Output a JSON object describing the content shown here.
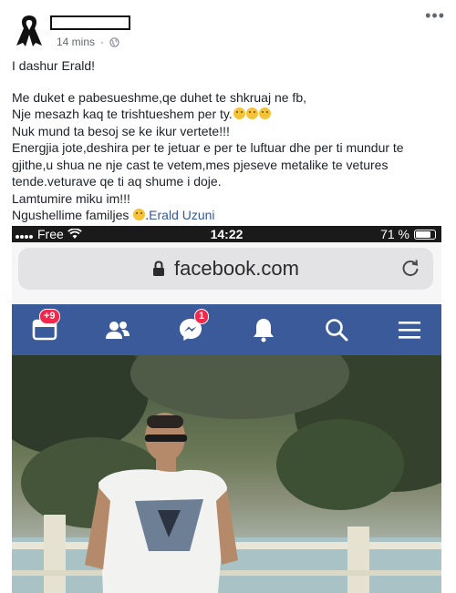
{
  "post": {
    "timestamp": "14 mins",
    "paragraphs": {
      "greeting": "I dashur Erald!",
      "l1": "Me duket e pabesueshme,qe duhet te shkruaj ne fb,",
      "l2": "Nje mesazh kaq te trishtueshem per ty.",
      "l3": "Nuk mund ta besoj se ke ikur vertete!!!",
      "l4": "Energjia jote,deshira per te jetuar e per te luftuar dhe per ti mundur te gjithe,u shua ne nje cast te vetem,mes pjeseve metalike te vetures tende.veturave qe ti aq shume i doje.",
      "l5": "Lamtumire miku im!!!",
      "l6": "Ngushellime familjes",
      "l6_sep": ".",
      "tag": "Erald Uzuni"
    }
  },
  "screenshot": {
    "carrier": "Free",
    "time": "14:22",
    "battery_text": "71 %",
    "battery_level": 0.71,
    "url": "facebook.com",
    "nav": {
      "notifications_badge": "+9",
      "messenger_badge": "1"
    }
  },
  "colors": {
    "fb_blue": "#3b5a9a",
    "link": "#365899",
    "badge_red": "#f02849"
  }
}
